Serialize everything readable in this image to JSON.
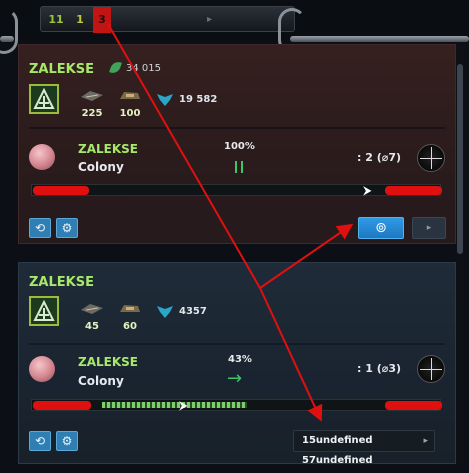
{
  "top_bar": {
    "counters": [
      "11",
      "1",
      "3"
    ],
    "glyph": "▸"
  },
  "panels": [
    {
      "owner": "ZALEKSE",
      "score": "34 015",
      "units": [
        "225",
        "100"
      ],
      "power": "19 582",
      "planet": {
        "name": "ZALEKSE",
        "type": "Colony"
      },
      "percent": "100%",
      "state_icon": "pause-icon",
      "slots": ": 2 (⌀7)",
      "progress": 0.0,
      "buttons": [
        "return-icon",
        "drone-icon"
      ],
      "action_icon": "target-icon",
      "next_glyph": "▸"
    },
    {
      "owner": "ZALEKSE",
      "power": "4357",
      "units": [
        "45",
        "60"
      ],
      "planet": {
        "name": "ZALEKSE",
        "type": "Colony"
      },
      "percent": "43%",
      "state_icon": "arrow-right-icon",
      "arrow_glyph": "→",
      "slots": ": 1 (⌀3)",
      "progress": 0.43,
      "buttons": [
        "return-icon",
        "gear-icon"
      ],
      "timer": "15undefined 57undefined",
      "timer_chevron": "▸"
    }
  ],
  "colors": {
    "accent_green": "#a7e86a",
    "annotation_red": "#e01010",
    "button_blue": "#2e9ae6"
  }
}
